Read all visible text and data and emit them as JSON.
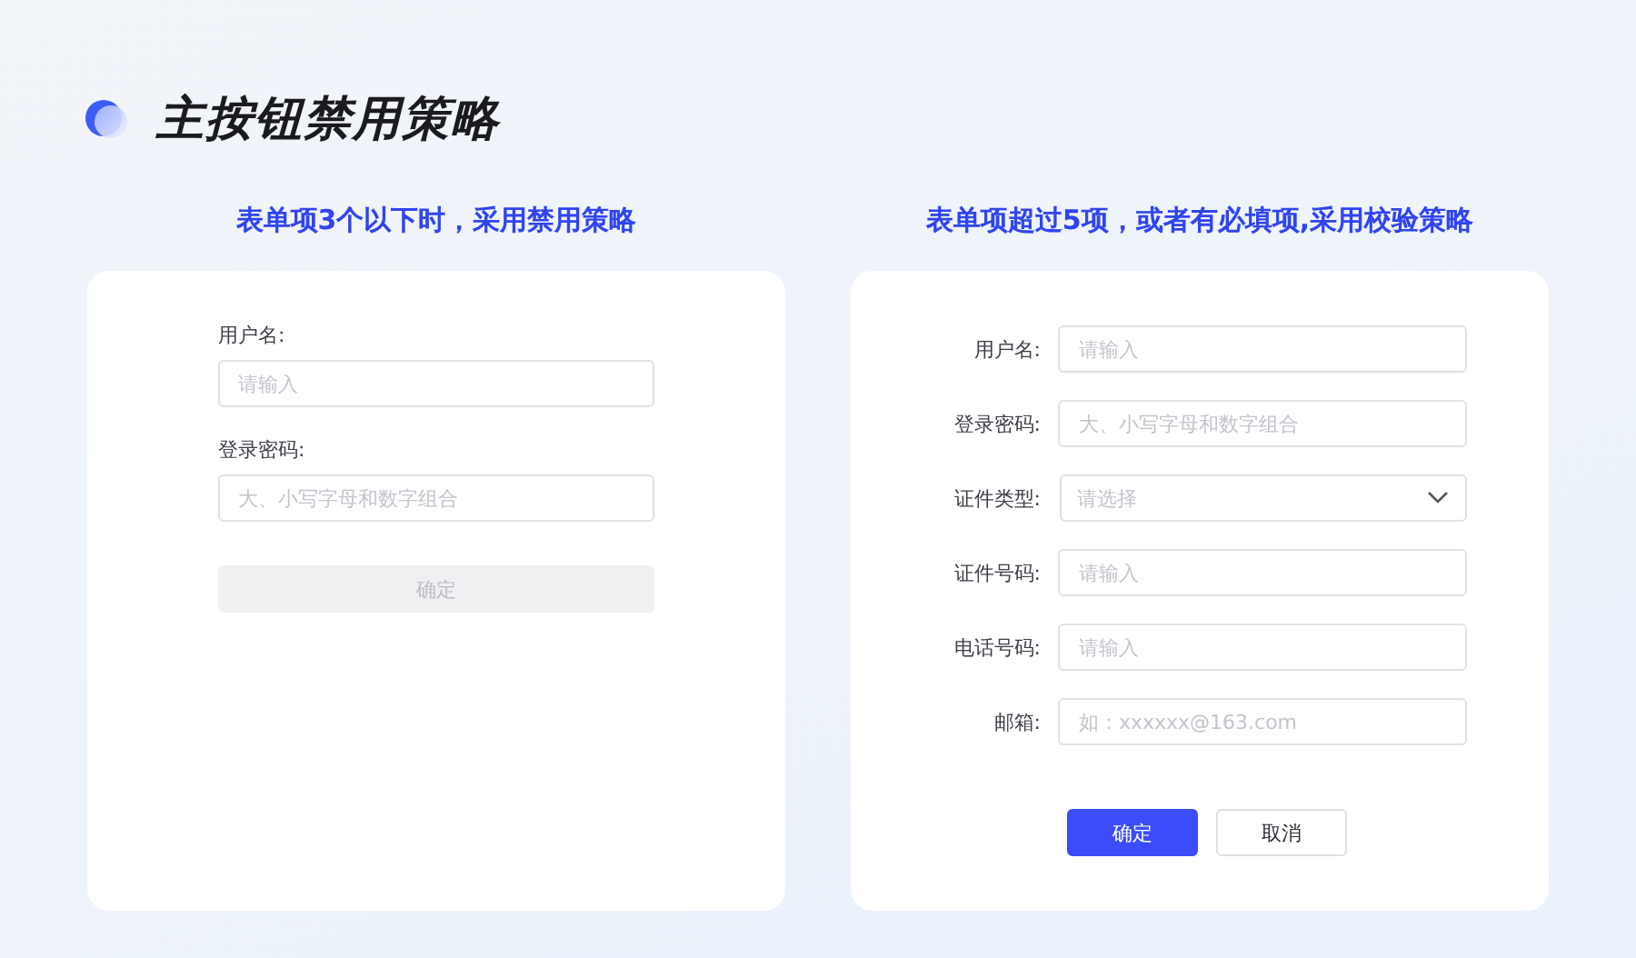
{
  "title": "主按钮禁用策略",
  "panels": [
    {
      "heading": "表单项3个以下时，采用禁用策略",
      "kind": "stacked",
      "fields": [
        {
          "label": "用户名:",
          "placeholder": "请输入",
          "kind": "input"
        },
        {
          "label": "登录密码:",
          "placeholder": "大、小写字母和数字组合",
          "kind": "input"
        }
      ],
      "buttons": [
        {
          "label": "确定",
          "kind": "primary",
          "disabled": true
        }
      ]
    },
    {
      "heading": "表单项超过5项，或者有必填项,采用校验策略",
      "kind": "inline",
      "fields": [
        {
          "label": "用户名:",
          "placeholder": "请输入",
          "kind": "input"
        },
        {
          "label": "登录密码:",
          "placeholder": "大、小写字母和数字组合",
          "kind": "input"
        },
        {
          "label": "证件类型:",
          "placeholder": "请选择",
          "kind": "select"
        },
        {
          "label": "证件号码:",
          "placeholder": "请输入",
          "kind": "input"
        },
        {
          "label": "电话号码:",
          "placeholder": "请输入",
          "kind": "input"
        },
        {
          "label": "邮箱:",
          "placeholder": "如：xxxxxx@163.com",
          "kind": "input"
        }
      ],
      "buttons": [
        {
          "label": "确定",
          "kind": "primary",
          "disabled": false
        },
        {
          "label": "取消",
          "kind": "secondary",
          "disabled": false
        }
      ]
    }
  ]
}
